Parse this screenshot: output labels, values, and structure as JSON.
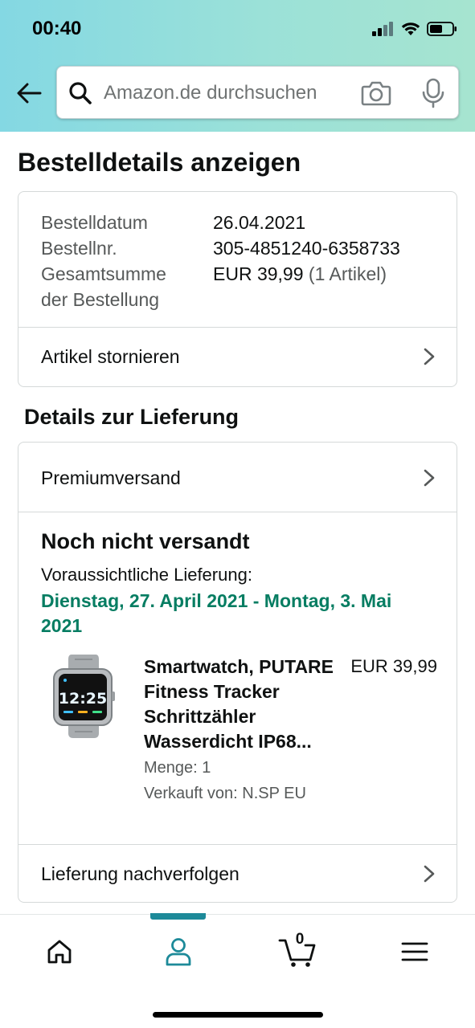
{
  "status_bar": {
    "time": "00:40"
  },
  "search": {
    "placeholder": "Amazon.de durchsuchen"
  },
  "page": {
    "title": "Bestelldetails anzeigen"
  },
  "order_summary": {
    "rows": [
      {
        "label": "Bestelldatum",
        "value": "26.04.2021"
      },
      {
        "label": "Bestellnr.",
        "value": "305-4851240-6358733"
      }
    ],
    "total_label_line1": "Gesamtsumme",
    "total_label_line2": "der Bestellung",
    "total_value": "EUR 39,99",
    "total_items": "(1 Artikel)",
    "cancel_label": "Artikel stornieren"
  },
  "delivery": {
    "section_title": "Details zur Lieferung",
    "shipping_method": "Premiumversand",
    "status": "Noch nicht versandt",
    "estimate_label": "Voraussichtliche Lieferung:",
    "estimate_date": "Dienstag, 27. April 2021 - Montag, 3. Mai 2021",
    "product": {
      "title": "Smartwatch, PUTARE Fitness Tracker Schrittzähler Wasserdicht IP68...",
      "price": "EUR 39,99",
      "quantity": "Menge: 1",
      "seller": "Verkauft von: N.SP EU",
      "watch_time": "12:25"
    },
    "track_label": "Lieferung nachverfolgen"
  },
  "bottom_nav": {
    "cart_count": "0",
    "active_color": "#1d8a99"
  },
  "colors": {
    "delivery_green": "#067d62",
    "header_gradient_start": "#84d8e3",
    "header_gradient_end": "#a6e4d0"
  }
}
